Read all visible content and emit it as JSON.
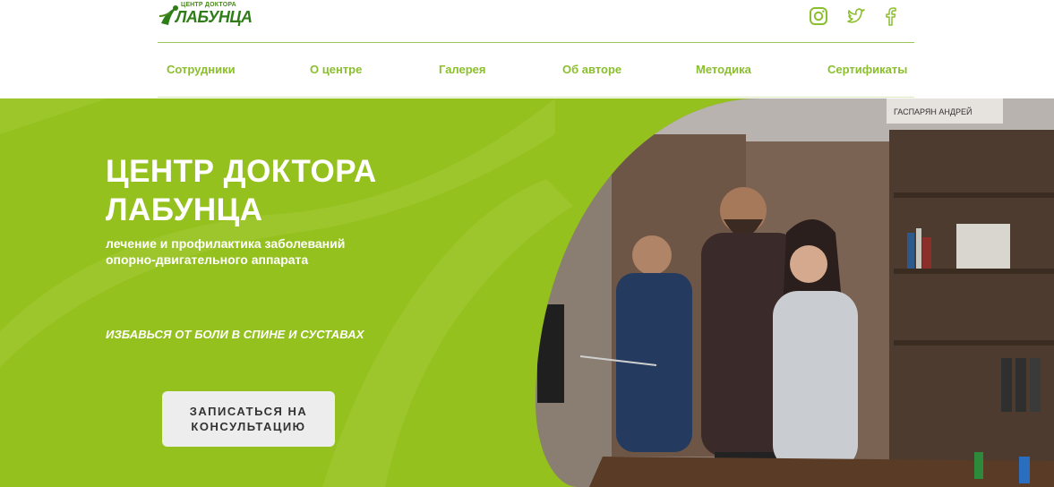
{
  "brand": {
    "logo_top": "ЦЕНТР ДОКТОРА",
    "logo_main": "ЛАБУНЦА",
    "accent_color": "#95c11f",
    "nav_color": "#8bbf2e"
  },
  "header": {
    "socials": [
      {
        "icon": "instagram-icon"
      },
      {
        "icon": "twitter-icon"
      },
      {
        "icon": "facebook-icon"
      }
    ],
    "nav": [
      {
        "label": "Сотрудники"
      },
      {
        "label": "О центре"
      },
      {
        "label": "Галерея"
      },
      {
        "label": "Об авторе"
      },
      {
        "label": "Методика"
      },
      {
        "label": "Сертификаты"
      }
    ]
  },
  "hero": {
    "title_line1": "ЦЕНТР ДОКТОРА",
    "title_line2": "ЛАБУНЦА",
    "subtitle_line1": "лечение и профилактика заболеваний",
    "subtitle_line2": "опорно-двигательного аппарата",
    "tagline": "ИЗБАВЬСЯ ОТ БОЛИ В СПИНЕ И СУСТАВАХ",
    "cta_line1": "ЗАПИСАТЬСЯ НА",
    "cta_line2": "КОНСУЛЬТАЦИЮ",
    "photo_sign": "ГАСПАРЯН АНДРЕЙ"
  }
}
